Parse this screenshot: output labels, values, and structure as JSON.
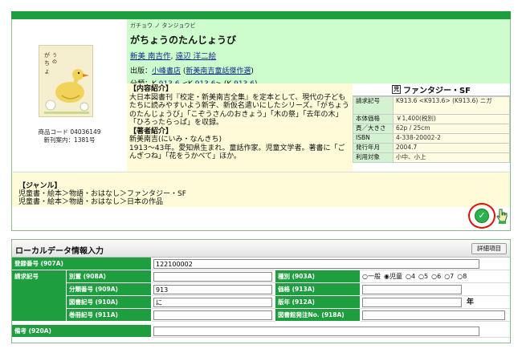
{
  "book": {
    "kana": "ガチョウ ノ タンジョウビ",
    "title": "がちょうのたんじょうび",
    "author": "新美 南吉作",
    "separator": ",",
    "illustrator": "遠辺 洋二絵",
    "publisher_label": "出版：",
    "publisher": "小峰書店",
    "series": "新美南吉童話傑作選",
    "classification_label": "分類：K",
    "class1": "913.6",
    "class2": "913.6",
    "class3": "913.6",
    "product_code": "商品コード 04036149",
    "new_guide": "新刊案内：1381号"
  },
  "description": {
    "content_heading": "【内容紹介】",
    "content_text": "大日本図書刊『校定・新美南吉全集』を定本として、現代の子どもたちに読みやすいよう新字、新仮名遣いにしたシリーズ。「がちょうのたんじょうび」「こぞうさんのおきょう」「木の祭」「去年の木」「ひろったらっぱ」を収録。",
    "author_heading": "【著者紹介】",
    "author_kana": "新美南吉(にいみ・なんきち)",
    "author_text": "1913～43年。愛知県生まれ。童話作家。児童文学者。著書に「ごんぎつね」「花をうかべて」ほか。"
  },
  "info": {
    "badge_mark": "児",
    "genre_badge": "ファンタジー・SF",
    "rows": [
      {
        "key": "請求記号",
        "value": "K913.6 <K913.6> (K913.6) ニガ"
      },
      {
        "key": "本体価格",
        "value": "￥1,400(税別)"
      },
      {
        "key": "頁／大きさ",
        "value": "62p / 25cm"
      },
      {
        "key": "ISBN",
        "value": "4-338-20002-2"
      },
      {
        "key": "発行年月",
        "value": "2004.7"
      },
      {
        "key": "利用対象",
        "value": "小中、小上"
      }
    ]
  },
  "genre": {
    "heading": "【ジャンル】",
    "line1": "児童書・絵本＞物語・おはなし＞ファンタジー・SF",
    "line2": "児童書・絵本＞物語・おはなし＞日本の作品"
  },
  "actions": {
    "check_symbol": "✓"
  },
  "local_data": {
    "title": "ローカルデータ情報入力",
    "detail_button": "詳細項目",
    "reg_label": "登録番号 (907A)",
    "reg_value": "122100002",
    "call_label": "請求記号",
    "betsu_label": "別置 (908A)",
    "betsu_value": "",
    "shubetsu_label": "種別 (903A)",
    "shubetsu_options": [
      "○一般",
      "◉児童",
      "○4",
      "○5",
      "○6",
      "○7",
      "○8"
    ],
    "bunrui_label": "分類番号 (909A)",
    "bunrui_value": "913",
    "kakaku_label": "価格 (913A)",
    "kakaku_value": "",
    "tosho_label": "図書記号 (910A)",
    "tosho_value": "に",
    "hanen_label": "版年 (912A)",
    "hanen_value": "",
    "nen_suffix": "年",
    "kansatsu_label": "巻冊記号 (911A)",
    "kansatsu_value": "",
    "hacchu_label": "図書館発注No. (918A)",
    "hacchu_value": "",
    "biko_label": "備考 (920A)",
    "biko_value": ""
  }
}
